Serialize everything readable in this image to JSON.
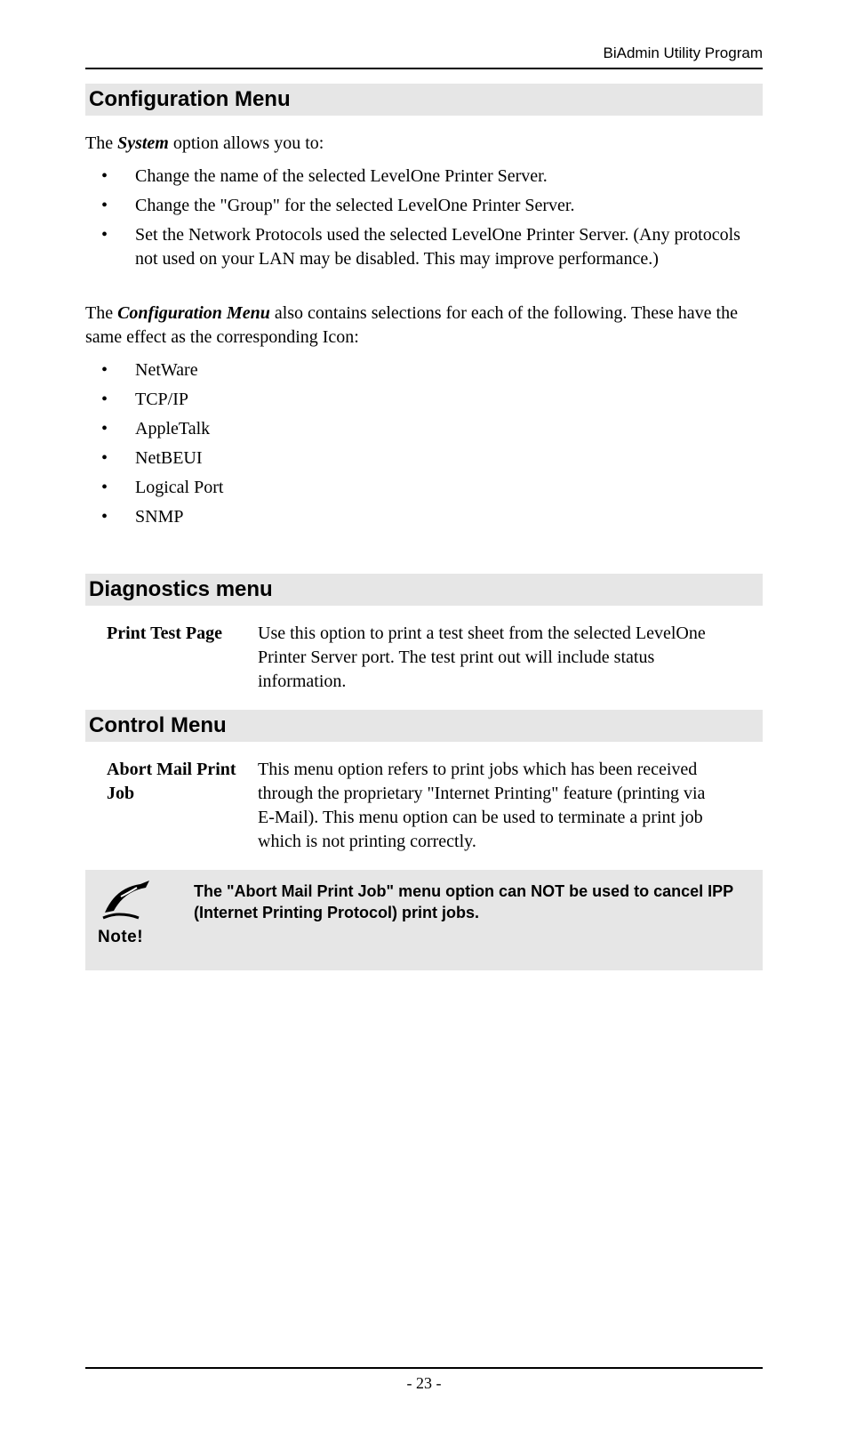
{
  "header": {
    "right": "BiAdmin Utility Program"
  },
  "sections": {
    "config": {
      "heading": "Configuration Menu",
      "intro_pre": "The ",
      "intro_emph": "System",
      "intro_post": " option allows you to:",
      "bullets1": [
        "Change the name of the selected LevelOne Printer Server.",
        "Change the \"Group\" for the selected LevelOne Printer Server.",
        "Set the Network Protocols used the selected LevelOne Printer Server. (Any protocols not used on your LAN may be disabled. This may improve performance.)"
      ],
      "para2_pre": "The ",
      "para2_emph": "Configuration Menu",
      "para2_post": " also contains selections for each of the following. These have the same effect as the corresponding Icon:",
      "bullets2": [
        "NetWare",
        "TCP/IP",
        "AppleTalk",
        "NetBEUI",
        "Logical Port",
        "SNMP"
      ]
    },
    "diag": {
      "heading": "Diagnostics menu",
      "term": "Print Test Page",
      "desc": "Use this option to print a test sheet from the selected LevelOne Printer Server port. The test print out will include status information."
    },
    "control": {
      "heading": "Control Menu",
      "term": "Abort Mail Print Job",
      "desc": "This menu option refers to print jobs which has been received through the proprietary \"Internet Printing\" feature (printing via E-Mail). This menu option can be used to terminate a print job which is not printing correctly."
    },
    "note": {
      "label": "Note!",
      "text": "The \"Abort Mail Print Job\" menu option can NOT be used to cancel IPP (Internet Printing Protocol) print jobs."
    }
  },
  "footer": {
    "page": "- 23 -"
  }
}
